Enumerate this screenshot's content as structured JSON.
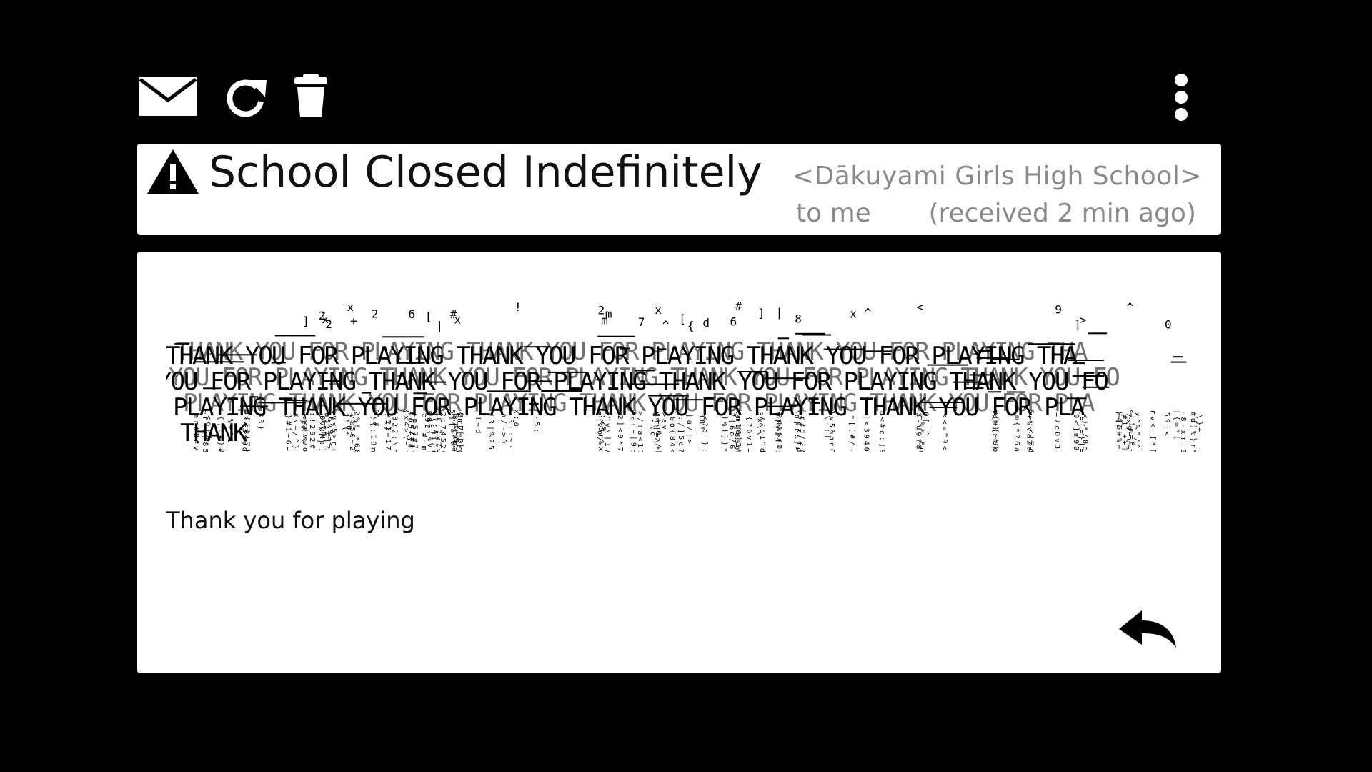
{
  "toolbar": {
    "icons": [
      "mail-icon",
      "refresh-icon",
      "trash-icon",
      "more-vertical-icon"
    ]
  },
  "email": {
    "subject": "School Closed Indefinitely",
    "sender": "<Dākuyami Girls High School>",
    "recipient": "to me",
    "received": "(received 2 min ago)",
    "glitch_lines": [
      "THANK YOU FOR PLAYING THANK YOU FOR PLAYING THANK YOU FOR PLAYING THA",
      "YOU FOR PLAYING THANK YOU FOR PLAYING THANK YOU FOR PLAYING THANK YOU FO",
      "PLAYING THANK YOU FOR PLAYING THANK YOU FOR PLAYING THANK YOU FOR PLA",
      "THANK"
    ],
    "message": "Thank you for playing"
  },
  "colors": {
    "background": "#000000",
    "panel": "#ffffff",
    "text": "#111111",
    "meta_text": "#8a8a8a"
  }
}
